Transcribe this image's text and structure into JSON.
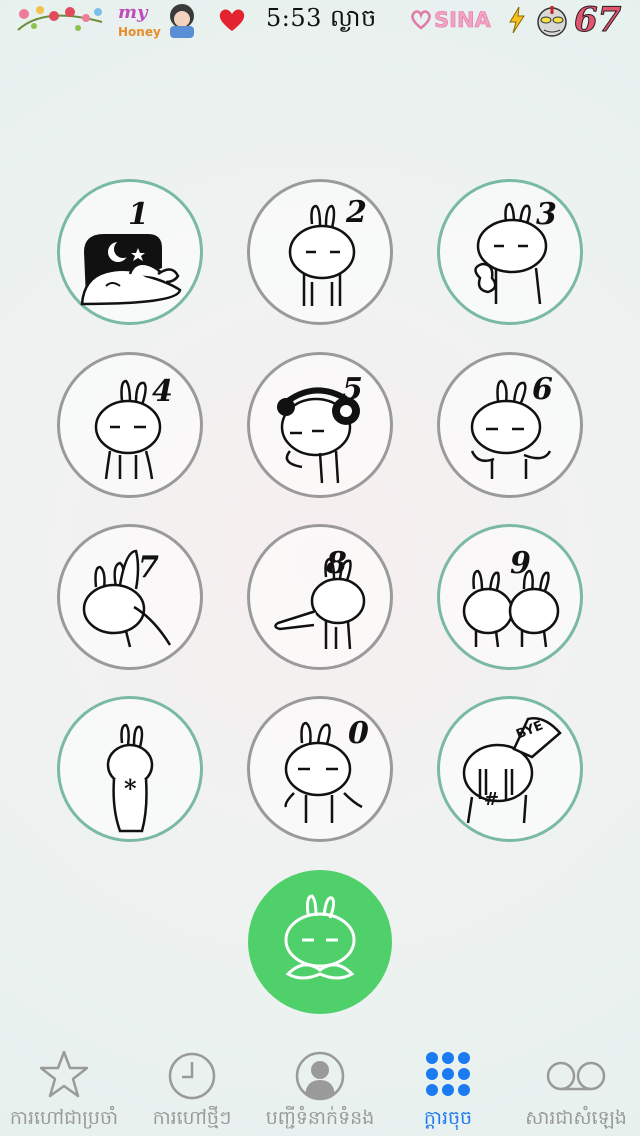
{
  "status_bar": {
    "time": "5:53 ល្ងាច",
    "carrier": "SINA",
    "decor_text": "my Honey",
    "battery_level": "67"
  },
  "keypad": {
    "keys": [
      {
        "digit": "1"
      },
      {
        "digit": "2"
      },
      {
        "digit": "3"
      },
      {
        "digit": "4"
      },
      {
        "digit": "5"
      },
      {
        "digit": "6"
      },
      {
        "digit": "7"
      },
      {
        "digit": "8"
      },
      {
        "digit": "9"
      },
      {
        "digit": "*"
      },
      {
        "digit": "0"
      },
      {
        "digit": "#"
      }
    ],
    "bubble_text": "BYE"
  },
  "call_button": {
    "icon": "bunny-call-icon",
    "color": "#4fd06a"
  },
  "tab_bar": {
    "tabs": [
      {
        "label": "ការហៅជាប្រចាំ",
        "icon": "star-icon"
      },
      {
        "label": "ការហៅថ្មីៗ",
        "icon": "clock-icon"
      },
      {
        "label": "បញ្ជីទំនាក់ទំនង",
        "icon": "contact-icon"
      },
      {
        "label": "ក្ដារចុច",
        "icon": "keypad-icon",
        "active": true
      },
      {
        "label": "សារជាសំឡេង",
        "icon": "voicemail-icon"
      }
    ],
    "active_color": "#1c7bf0",
    "inactive_color": "#9a9a9a"
  }
}
